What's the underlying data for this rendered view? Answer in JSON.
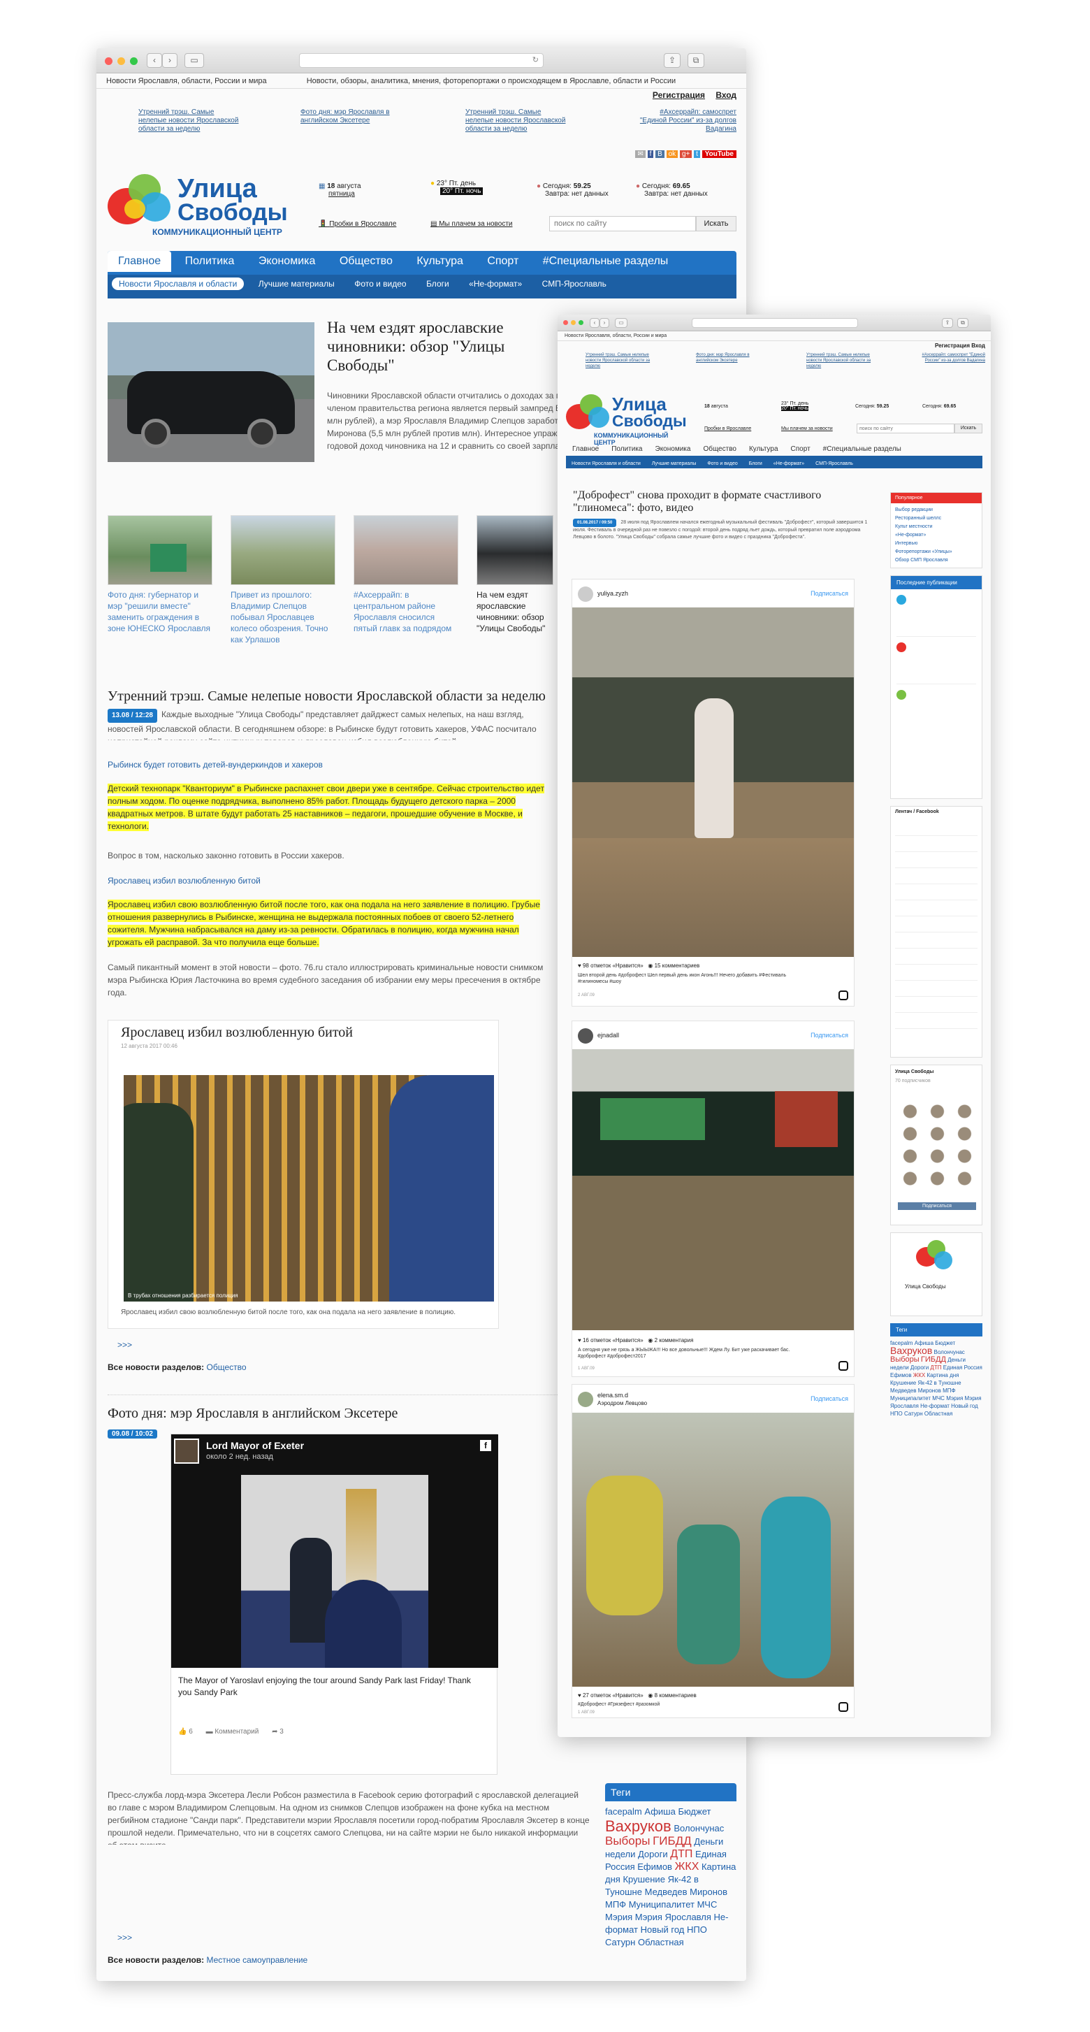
{
  "site": {
    "logo_line1": "Улица",
    "logo_line2": "Свободы",
    "logo_sub": "КОММУНИКАЦИОННЫЙ ЦЕНТР"
  },
  "top": {
    "left": "Новости Ярославля, области, России и мира",
    "center": "Новости, обзоры, аналитика, мнения, фоторепортажи о происходящем в Ярославле, области и России",
    "register": "Регистрация",
    "login": "Вход"
  },
  "teasers": [
    "Утренний трэш. Самые нелепые новости Ярославской области за неделю",
    "Фото дня: мэр Ярославля в английском Эксетере",
    "Утренний трэш. Самые нелепые новости Ярославской области за неделю",
    "#Ахсеррайп: самоспрет \"Единой России\" из-за долгов Вадагина"
  ],
  "info": {
    "date_day": "18",
    "date_month": "августа",
    "weekday": "пятница",
    "weather": "23° Пт. день",
    "weather2": "20° Пт. ночь",
    "rate1_label": "Сегодня:",
    "rate1": "59.25",
    "rate1_tom": "Завтра: нет данных",
    "rate2_label": "Сегодня:",
    "rate2": "69.65",
    "rate2_tom": "Завтра: нет данных",
    "traffic": "Пробки в Ярославле",
    "map": "Мы плачем за новости",
    "search_placeholder": "поиск по сайту",
    "search_btn": "Искать"
  },
  "nav": [
    "Главное",
    "Политика",
    "Экономика",
    "Общество",
    "Культура",
    "Спорт",
    "#Специальные разделы"
  ],
  "subnav": [
    "Новости Ярославля и области",
    "Лучшие материалы",
    "Фото и видео",
    "Блоги",
    "«Не-формат»",
    "СМП-Ярославль"
  ],
  "lead": {
    "title": "На чем ездят ярославские чиновники: обзор \"Улицы Свободы\"",
    "text": "Чиновники Ярославской области отчитались о доходах за год. Как оказалось, самым состоятельным членом правительства региона является первый зампред Виктор Костин (годовой доход превысил 20,7 млн рублей), а мэр Ярославля Владимир Слепцов заработал больше врио губернатора Дмитрия Миронова (5,5 млн рублей против млн). Интересное упражнение для рядового гражданина – разделить годовой доход чиновника на 12 и сравнить со своей зарплатой. Но мы пошли по более эстетическ"
  },
  "thumbs": [
    "Фото дня: губернатор и мэр \"решили вместе\" заменить ограждения в зоне ЮНЕСКО Ярославля",
    "Привет из прошлого: Владимир Слепцов побывал Ярославцев колесо обозрения. Точно как Урлашов",
    "#Ахсеррайп: в центральном районе Ярославля сносился пятый главк за подрядом",
    "На чем ездят ярославские чиновники: обзор \"Улицы Свободы\""
  ],
  "article1": {
    "title": "Утренний трэш. Самые нелепые новости Ярославской области за неделю",
    "date": "13.08 / 12:28",
    "intro": "Каждые выходные \"Улица Свободы\" представляет дайджест самых нелепых, на наш взгляд, новостей Ярославской области. В сегодняшнем обзоре: в Рыбинске будут готовить хакеров, УФАС посчитало непристойной рекламу сайта интимных товаров и ярославец избил возлюбленную битой.",
    "link1": "Рыбинск будет готовить детей-вундеркиндов и хакеров",
    "hl1": "Детский технопарк \"Кванториум\" в Рыбинске распахнет свои двери уже в сентябре. Сейчас строительство идет полным ходом. По оценке подрядчика, выполнено 85% работ. Площадь будущего детского парка – 2000 квадратных метров. В штате будут работать 25 наставников – педагоги, прошедшие обучение в Москве, и технологи.",
    "p2": "Вопрос в том, насколько законно готовить в России хакеров.",
    "link2": "Ярославец избил возлюбленную битой",
    "hl2": "Ярославец избил свою возлюбленную битой после того, как она подала на него заявление в полицию. Грубые отношения развернулись в Рыбинске, женщина не выдержала постоянных побоев от своего 52-летнего сожителя. Мужчина набрасывался на даму из-за ревности. Обратилась в полицию, когда мужчина начал угрожать ей расправой. За что получила еще больше.",
    "p3": "Самый пикантный момент в этой новости – фото. 76.ru стало иллюстрировать криминальные новости снимком мэра Рыбинска Юрия Ласточкина во время судебного заседания об избрании ему меры пресечения в октябре года.",
    "embed_title": "Ярославец избил возлюбленную битой",
    "embed_date": "12 августа 2017 00:46",
    "embed_caption": "Ярославец избил свою возлюбленную битой после того, как она подала на него заявление в полицию.",
    "photo_caption": "В трубах отношения разбирается полиция",
    "more": ">>>",
    "section_label": "Все новости разделов:",
    "section": "Общество"
  },
  "article2": {
    "title": "Фото дня: мэр Ярославля в английском Эксетере",
    "date": "09.08 / 10:02",
    "fb_name": "Lord Mayor of Exeter",
    "fb_time": "около 2 нед. назад",
    "fb_text": "The Mayor of Yaroslavl enjoying the tour around Sandy Park last Friday! Thank you Sandy Park",
    "fb_likes": "6",
    "fb_comments": "Комментарий",
    "fb_shares": "3",
    "text": "Пресс-служба лорд-мэра Эксетера Лесли Робсон разместила в Facebook серию фотографий с ярославской делегацией во главе с мэром Владимиром Слепцовым. На одном из снимков Слепцов изображен на фоне кубка на местном регбийном стадионе \"Санди парк\". Представители мэрии Ярославля посетили город-побратим Ярославля Эксетер в конце прошлой недели. Примечательно, что ни в соцсетях самого Слепцова, ни на сайте мэрии не было никакой информации об этом визите.",
    "more": ">>>",
    "section_label": "Все новости разделов:",
    "section": "Местное самоуправление"
  },
  "tags_title": "Теги",
  "tags": [
    "facepalm",
    "Афиша",
    "Бюджет",
    "Вахруков",
    "Волончунас",
    "Выборы",
    "ГИБДД",
    "Деньги",
    "недели",
    "Дороги",
    "ДТП",
    "Единая",
    "Россия",
    "Ефимов",
    "ЖКХ",
    "Картина",
    "дня",
    "Крушение",
    "Як-42 в Туношне",
    "Медведев",
    "Миронов",
    "МПФ",
    "Муниципалитет",
    "МЧС",
    "Мэрия",
    "Мэрия Ярославля",
    "Не-формат",
    "Новый год",
    "НПО Сатурн",
    "Областная"
  ],
  "w2": {
    "title": "\"Доброфест\" снова проходит в формате счастливого \"глиномеса\": фото, видео",
    "date": "01.08.2017 / 09:50",
    "intro": "28 июля под Ярославлем начался ежегодный музыкальный фестиваль \"Доброфест\", который завершится 1 июля. Фестиваль в очередной раз не повезло с погодой: второй день подряд льет дождь, который превратил поле аэродрома Левцово в болото. \"Улица Свободы\" собрала самые лучшие фото и видео с праздника \"Доброфеста\".",
    "posts": [
      {
        "user": "yuliya.zyzh",
        "subscribe": "Подписаться",
        "likes": "98 отметок «Нравится»",
        "comments": "15 комментариев",
        "caption": "Шел второй день #доброфест Шел первый день икон Агонь!!! Нечего добавить #Фестиваль #гилиномесы #шоу",
        "time": "2 АВГ.09"
      },
      {
        "user": "ejnadall",
        "subscribe": "Подписаться",
        "likes": "16 отметок «Нравится»",
        "comments": "2 комментария",
        "caption": "А сегодня уже не грязь а ЖЫЫЖА!!! Но все довольные!!! Ждем Лу. Бит уже раскачивает бас. #доброфест #доброфест2017",
        "time": "1 АВГ.09"
      },
      {
        "user": "elena.sm.d",
        "location": "Аэродром Левцово",
        "subscribe": "Подписаться",
        "likes": "27 отметок «Нравится»",
        "comments": "8 комментариев",
        "caption": "#Доброфест #Грязефест #разомкой",
        "time": "1 АВГ.09"
      }
    ],
    "popular_title": "Популярное",
    "popular": [
      "Выбор редакции",
      "Ресторанный шеллс",
      "Культ местности",
      "«Не-формат»",
      "Интервью",
      "Фоторепортажи «Улицы»",
      "Обзор СМП Ярославля"
    ],
    "recent_title": "Последние публикации",
    "lenta_title": "Лентач / Facebook",
    "community": "Улица Свободы",
    "subscribers": "70 подписчиков",
    "follow": "Подписаться",
    "tags_title": "Теги"
  }
}
